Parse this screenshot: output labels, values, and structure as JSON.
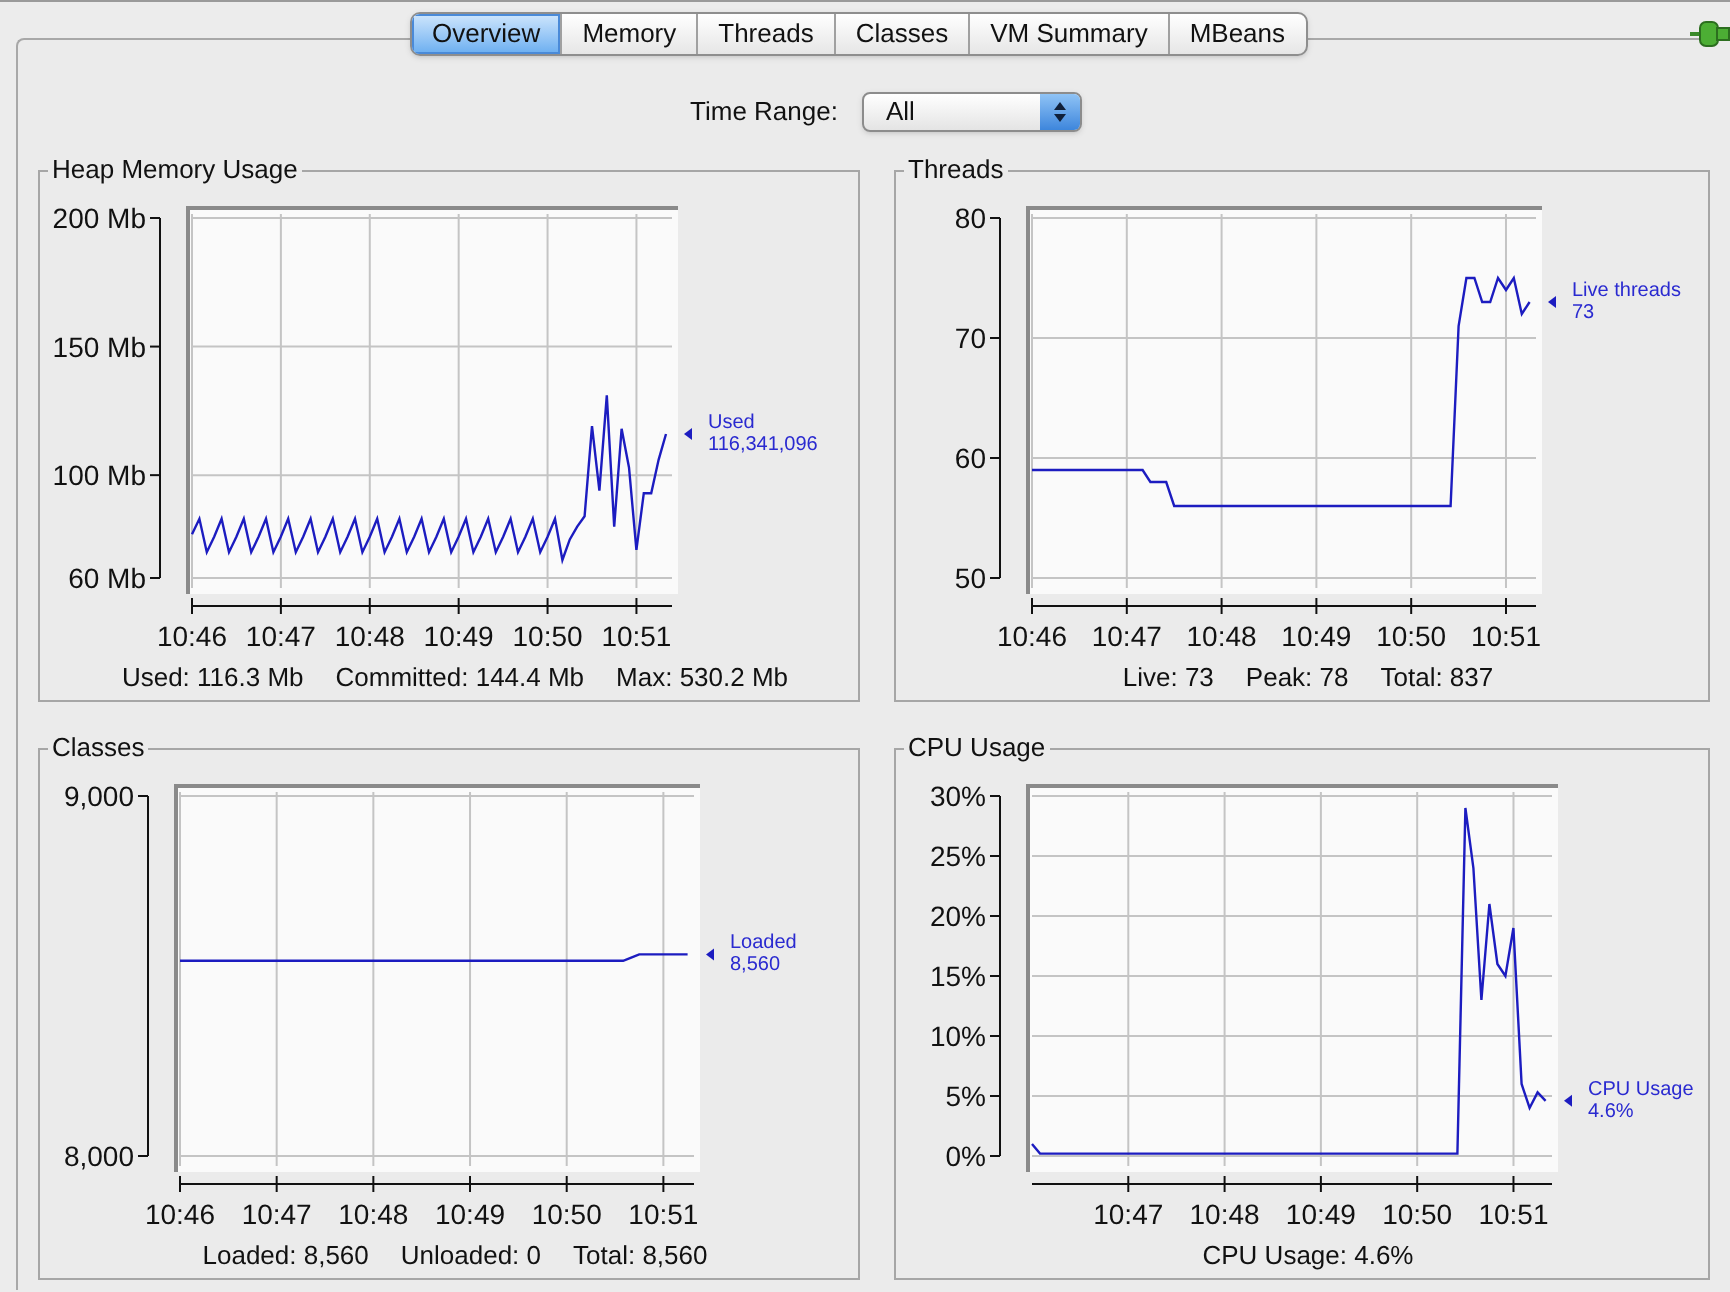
{
  "tabs": [
    {
      "label": "Overview",
      "selected": true
    },
    {
      "label": "Memory",
      "selected": false
    },
    {
      "label": "Threads",
      "selected": false
    },
    {
      "label": "Classes",
      "selected": false
    },
    {
      "label": "VM Summary",
      "selected": false
    },
    {
      "label": "MBeans",
      "selected": false
    }
  ],
  "time_range": {
    "label": "Time Range:",
    "value": "All"
  },
  "panels": [
    {
      "title": "Heap Memory Usage",
      "legend": {
        "value": "116,341,096"
      },
      "stats": [
        "Used: 116.3 Mb",
        "Committed: 144.4 Mb",
        "Max: 530.2 Mb"
      ],
      "chart_data": {
        "type": "line",
        "grid": true,
        "ylim": [
          60,
          200
        ],
        "yticks": [
          {
            "value": 60,
            "label": "60 Mb"
          },
          {
            "value": 100,
            "label": "100 Mb"
          },
          {
            "value": 150,
            "label": "150 Mb"
          },
          {
            "value": 200,
            "label": "200 Mb"
          }
        ],
        "categories": [
          "10:46",
          null,
          null,
          null,
          null,
          null,
          null,
          null,
          null,
          null,
          null,
          null,
          "10:47",
          null,
          null,
          null,
          null,
          null,
          null,
          null,
          null,
          null,
          null,
          null,
          "10:48",
          null,
          null,
          null,
          null,
          null,
          null,
          null,
          null,
          null,
          null,
          null,
          "10:49",
          null,
          null,
          null,
          null,
          null,
          null,
          null,
          null,
          null,
          null,
          null,
          "10:50",
          null,
          null,
          null,
          null,
          null,
          null,
          null,
          null,
          null,
          null,
          null,
          "10:51",
          null,
          null,
          null,
          null
        ],
        "series": [
          {
            "name": "Used",
            "color": "#1c1cc0",
            "values": [
              77,
              83,
              70,
              76,
              83,
              70,
              76,
              83,
              70,
              76,
              83,
              70,
              76,
              83,
              70,
              76,
              83,
              70,
              76,
              83,
              70,
              76,
              83,
              70,
              76,
              83,
              70,
              76,
              83,
              70,
              76,
              83,
              70,
              76,
              83,
              70,
              76,
              83,
              70,
              76,
              83,
              70,
              76,
              83,
              70,
              76,
              83,
              70,
              76,
              83,
              67,
              75,
              80,
              84,
              119,
              94,
              131,
              80,
              118,
              103,
              71,
              93,
              93,
              106,
              116
            ]
          }
        ]
      }
    },
    {
      "title": "Threads",
      "legend": {
        "value": "73"
      },
      "stats": [
        "Live: 73",
        "Peak: 78",
        "Total: 837"
      ],
      "chart_data": {
        "type": "line",
        "grid": true,
        "ylim": [
          50,
          80
        ],
        "yticks": [
          50,
          60,
          70,
          80
        ],
        "categories": [
          "10:46",
          null,
          null,
          null,
          null,
          null,
          null,
          null,
          null,
          null,
          null,
          null,
          "10:47",
          null,
          null,
          null,
          null,
          null,
          null,
          null,
          null,
          null,
          null,
          null,
          "10:48",
          null,
          null,
          null,
          null,
          null,
          null,
          null,
          null,
          null,
          null,
          null,
          "10:49",
          null,
          null,
          null,
          null,
          null,
          null,
          null,
          null,
          null,
          null,
          null,
          "10:50",
          null,
          null,
          null,
          null,
          null,
          null,
          null,
          null,
          null,
          null,
          null,
          "10:51",
          null,
          null,
          null
        ],
        "series": [
          {
            "name": "Live threads",
            "color": "#1c1cc0",
            "values": [
              59,
              59,
              59,
              59,
              59,
              59,
              59,
              59,
              59,
              59,
              59,
              59,
              59,
              59,
              59,
              58,
              58,
              58,
              56,
              56,
              56,
              56,
              56,
              56,
              56,
              56,
              56,
              56,
              56,
              56,
              56,
              56,
              56,
              56,
              56,
              56,
              56,
              56,
              56,
              56,
              56,
              56,
              56,
              56,
              56,
              56,
              56,
              56,
              56,
              56,
              56,
              56,
              56,
              56,
              71,
              75,
              75,
              73,
              73,
              75,
              74,
              75,
              72,
              73
            ]
          }
        ]
      }
    },
    {
      "title": "Classes",
      "legend": {
        "value": "8,560"
      },
      "stats": [
        "Loaded: 8,560",
        "Unloaded: 0",
        "Total: 8,560"
      ],
      "chart_data": {
        "type": "line",
        "grid": true,
        "ylim": [
          8000,
          9000
        ],
        "yticks": [
          {
            "value": 8000,
            "label": "8,000"
          },
          {
            "value": 9000,
            "label": "9,000"
          }
        ],
        "categories": [
          "10:46",
          null,
          null,
          null,
          null,
          null,
          null,
          null,
          null,
          null,
          null,
          null,
          "10:47",
          null,
          null,
          null,
          null,
          null,
          null,
          null,
          null,
          null,
          null,
          null,
          "10:48",
          null,
          null,
          null,
          null,
          null,
          null,
          null,
          null,
          null,
          null,
          null,
          "10:49",
          null,
          null,
          null,
          null,
          null,
          null,
          null,
          null,
          null,
          null,
          null,
          "10:50",
          null,
          null,
          null,
          null,
          null,
          null,
          null,
          null,
          null,
          null,
          null,
          "10:51",
          null,
          null,
          null
        ],
        "series": [
          {
            "name": "Loaded",
            "color": "#1c1cc0",
            "values": [
              8542,
              8542,
              8542,
              8542,
              8542,
              8542,
              8542,
              8542,
              8542,
              8542,
              8542,
              8542,
              8542,
              8542,
              8542,
              8542,
              8542,
              8542,
              8542,
              8542,
              8542,
              8542,
              8542,
              8542,
              8542,
              8542,
              8542,
              8542,
              8542,
              8542,
              8542,
              8542,
              8542,
              8542,
              8542,
              8542,
              8542,
              8542,
              8542,
              8542,
              8542,
              8542,
              8542,
              8542,
              8542,
              8542,
              8542,
              8542,
              8542,
              8542,
              8542,
              8542,
              8542,
              8542,
              8542,
              8542,
              8551,
              8560,
              8560,
              8560,
              8560,
              8560,
              8560,
              8560
            ]
          }
        ]
      }
    },
    {
      "title": "CPU Usage",
      "legend": {
        "value": "4.6%"
      },
      "stats": [
        "CPU Usage: 4.6%"
      ],
      "chart_data": {
        "type": "line",
        "grid": true,
        "ylim": [
          0,
          30
        ],
        "yticks": [
          {
            "value": 0,
            "label": "0%"
          },
          {
            "value": 5,
            "label": "5%"
          },
          {
            "value": 10,
            "label": "10%"
          },
          {
            "value": 15,
            "label": "15%"
          },
          {
            "value": 20,
            "label": "20%"
          },
          {
            "value": 25,
            "label": "25%"
          },
          {
            "value": 30,
            "label": "30%"
          }
        ],
        "categories": [
          null,
          null,
          null,
          null,
          null,
          null,
          null,
          null,
          null,
          null,
          null,
          null,
          "10:47",
          null,
          null,
          null,
          null,
          null,
          null,
          null,
          null,
          null,
          null,
          null,
          "10:48",
          null,
          null,
          null,
          null,
          null,
          null,
          null,
          null,
          null,
          null,
          null,
          "10:49",
          null,
          null,
          null,
          null,
          null,
          null,
          null,
          null,
          null,
          null,
          null,
          "10:50",
          null,
          null,
          null,
          null,
          null,
          null,
          null,
          null,
          null,
          null,
          null,
          "10:51",
          null,
          null,
          null,
          null
        ],
        "series": [
          {
            "name": "CPU Usage",
            "color": "#1c1cc0",
            "values": [
              1,
              0.2,
              0.2,
              0.2,
              0.2,
              0.2,
              0.2,
              0.2,
              0.2,
              0.2,
              0.2,
              0.2,
              0.2,
              0.2,
              0.2,
              0.2,
              0.2,
              0.2,
              0.2,
              0.2,
              0.2,
              0.2,
              0.2,
              0.2,
              0.2,
              0.2,
              0.2,
              0.2,
              0.2,
              0.2,
              0.2,
              0.2,
              0.2,
              0.2,
              0.2,
              0.2,
              0.2,
              0.2,
              0.2,
              0.2,
              0.2,
              0.2,
              0.2,
              0.2,
              0.2,
              0.2,
              0.2,
              0.2,
              0.2,
              0.2,
              0.2,
              0.2,
              0.2,
              0.2,
              29,
              24,
              13,
              21,
              16,
              15,
              19,
              6,
              4,
              5.3,
              4.6
            ]
          }
        ]
      }
    }
  ]
}
